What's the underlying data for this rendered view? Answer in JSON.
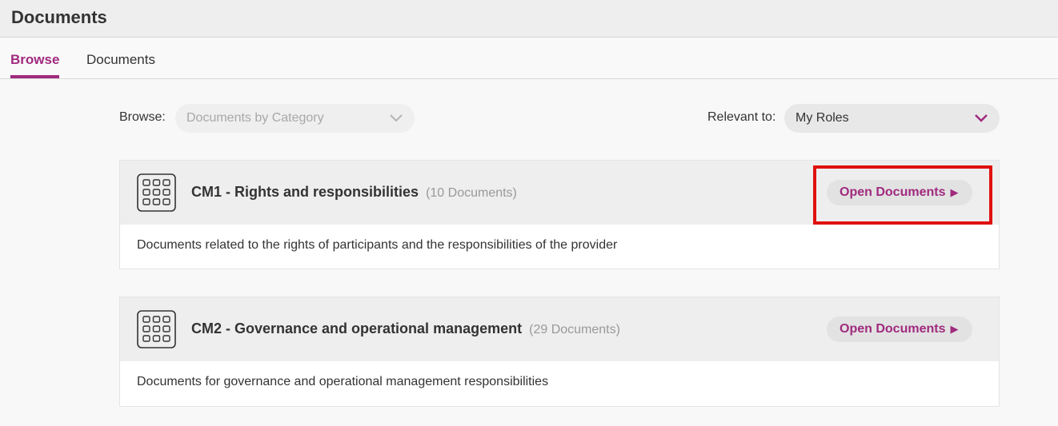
{
  "header": {
    "title": "Documents"
  },
  "tabs": [
    {
      "label": "Browse",
      "active": true
    },
    {
      "label": "Documents",
      "active": false
    }
  ],
  "filters": {
    "browse_label": "Browse:",
    "browse_value": "Documents by Category",
    "relevant_label": "Relevant to:",
    "relevant_value": "My Roles"
  },
  "categories": [
    {
      "title": "CM1 - Rights and responsibilities",
      "count": "(10 Documents)",
      "description": "Documents related to the rights of participants and the responsibilities of the provider",
      "button_label": "Open Documents",
      "button_arrow": "▶"
    },
    {
      "title": "CM2 - Governance and operational management",
      "count": "(29 Documents)",
      "description": "Documents for governance and operational management responsibilities",
      "button_label": "Open Documents",
      "button_arrow": "▶"
    }
  ],
  "colors": {
    "accent": "#a02a7e",
    "highlight": "#e01010"
  },
  "icons": {
    "category": "grid-icon",
    "dropdown": "chevron-down-icon"
  }
}
